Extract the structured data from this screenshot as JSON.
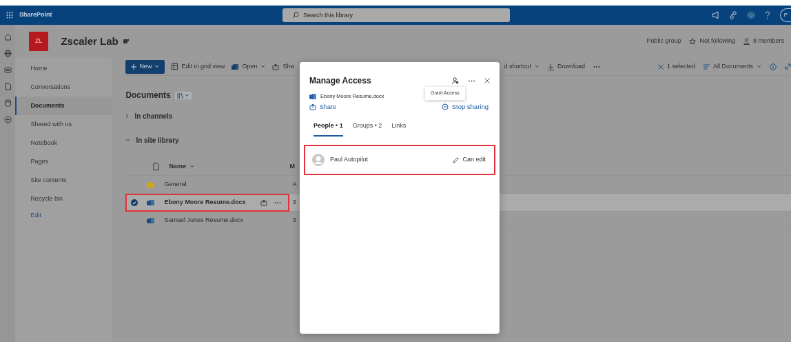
{
  "app_bar": {
    "app_name": "SharePoint",
    "search": {
      "placeholder": "Search this library"
    },
    "avatar_initials": "P"
  },
  "site": {
    "logo_initials": "ZL",
    "title": "Zscaler Lab",
    "public_label": "Public group",
    "follow_label": "Not following",
    "members_label": "8 members"
  },
  "site_nav": [
    {
      "label": "Home",
      "selected": false
    },
    {
      "label": "Conversations",
      "selected": false
    },
    {
      "label": "Documents",
      "selected": true
    },
    {
      "label": "Shared with us",
      "selected": false
    },
    {
      "label": "Notebook",
      "selected": false
    },
    {
      "label": "Pages",
      "selected": false
    },
    {
      "label": "Site contents",
      "selected": false
    },
    {
      "label": "Recycle bin",
      "selected": false
    }
  ],
  "site_nav_edit": "Edit",
  "command_bar": {
    "new_label": "New",
    "grid_label": "Edit in grid view",
    "open_label": "Open",
    "share_label": "Sha",
    "shortcut_label": "d shortcut",
    "download_label": "Download",
    "selection_label": "1 selected",
    "view_label": "All Documents"
  },
  "library": {
    "title": "Documents",
    "sections": [
      {
        "label": "In channels",
        "expanded": false
      },
      {
        "label": "In site library",
        "expanded": true
      }
    ],
    "columns": [
      "Name",
      "M"
    ],
    "rows": [
      {
        "name": "General",
        "kind": "folder",
        "column_2": "A",
        "selected": false,
        "highlighted": false
      },
      {
        "name": "Ebony Moore Resume.docx",
        "kind": "document",
        "column_2": "3",
        "selected": true,
        "highlighted": true
      },
      {
        "name": "Samuel Jones Resume.docx",
        "kind": "document",
        "column_2": "3",
        "selected": false,
        "highlighted": false
      }
    ]
  },
  "dialog": {
    "title": "Manage Access",
    "file_name": "Ebony Moore Resume.docx",
    "share_label": "Share",
    "stop_sharing_label": "Stop sharing",
    "tooltip": "Grant Access",
    "tabs": [
      {
        "label": "People • 1",
        "selected": true
      },
      {
        "label": "Groups • 2",
        "selected": false
      },
      {
        "label": "Links",
        "selected": false
      }
    ],
    "people": [
      {
        "name": "Paul Autopilot",
        "permission": "Can edit",
        "highlighted": true
      }
    ]
  }
}
